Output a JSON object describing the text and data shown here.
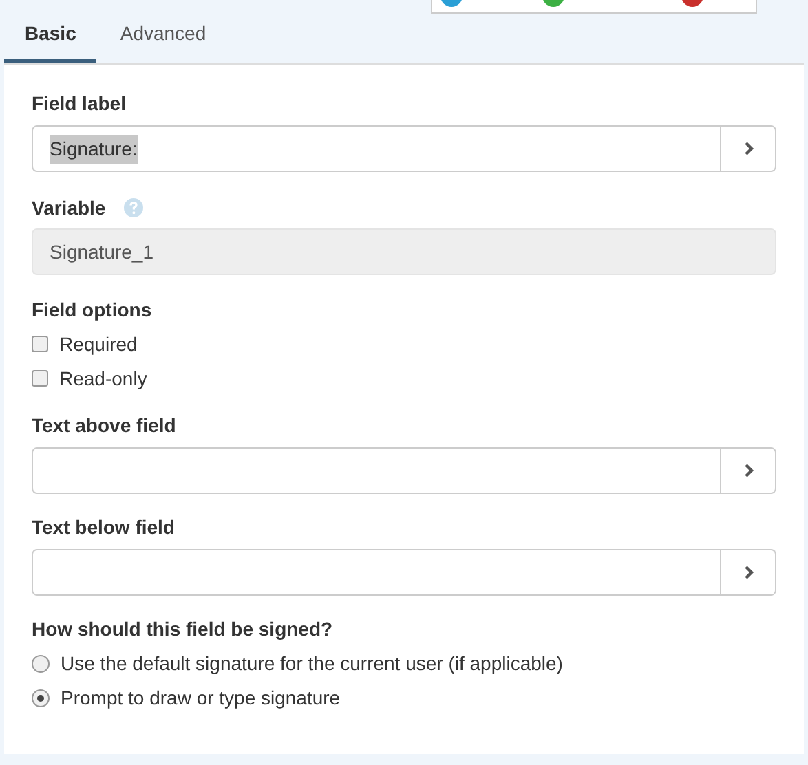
{
  "status_dots": [
    {
      "color": "#2a9fd6"
    },
    {
      "color": "#3cb043"
    },
    {
      "color": "#c9302c"
    }
  ],
  "tabs": [
    {
      "label": "Basic",
      "selected": true
    },
    {
      "label": "Advanced",
      "selected": false
    }
  ],
  "field_label": {
    "label": "Field label",
    "value": "Signature:",
    "value_selected": true
  },
  "variable": {
    "label": "Variable",
    "value": "Signature_1",
    "disabled": true
  },
  "field_options": {
    "label": "Field options",
    "options": [
      {
        "label": "Required",
        "checked": false
      },
      {
        "label": "Read-only",
        "checked": false
      }
    ]
  },
  "text_above": {
    "label": "Text above field"
  },
  "text_below": {
    "label": "Text below field"
  },
  "signing": {
    "label": "How should this field be signed?",
    "options": [
      {
        "label": "Use the default signature for the current user (if applicable)",
        "selected": false
      },
      {
        "label": "Prompt to draw or type signature",
        "selected": true
      }
    ]
  }
}
